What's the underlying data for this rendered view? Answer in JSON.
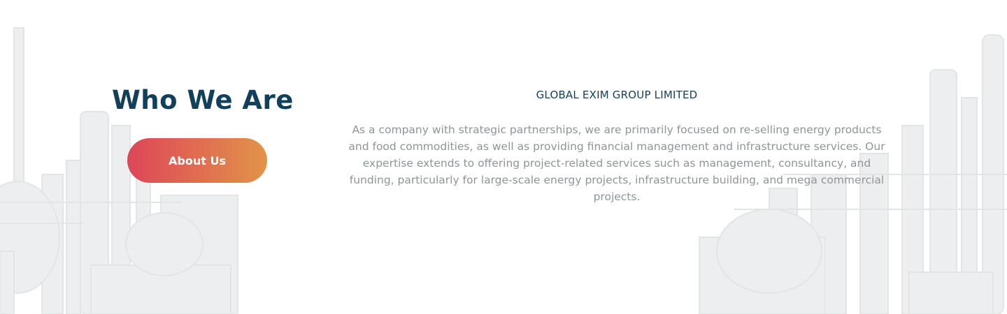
{
  "who_we_are": {
    "title": "Who We Are",
    "button_label": "About Us",
    "company_name": "GLOBAL EXIM GROUP LIMITED",
    "description": "As a company with strategic partnerships, we are primarily focused on re-selling energy products and food commodities, as well as providing financial management and infrastructure services. Our expertise extends to offering project-related services such as management, consultancy, and funding, particularly for large-scale energy projects, infrastructure building, and mega commercial projects."
  },
  "colors": {
    "heading": "#123f5a",
    "body_text": "#8f9497",
    "button_gradient_start": "#de4658",
    "button_gradient_end": "#e2934a",
    "background": "#ffffff",
    "background_art": "#e9ebec"
  }
}
